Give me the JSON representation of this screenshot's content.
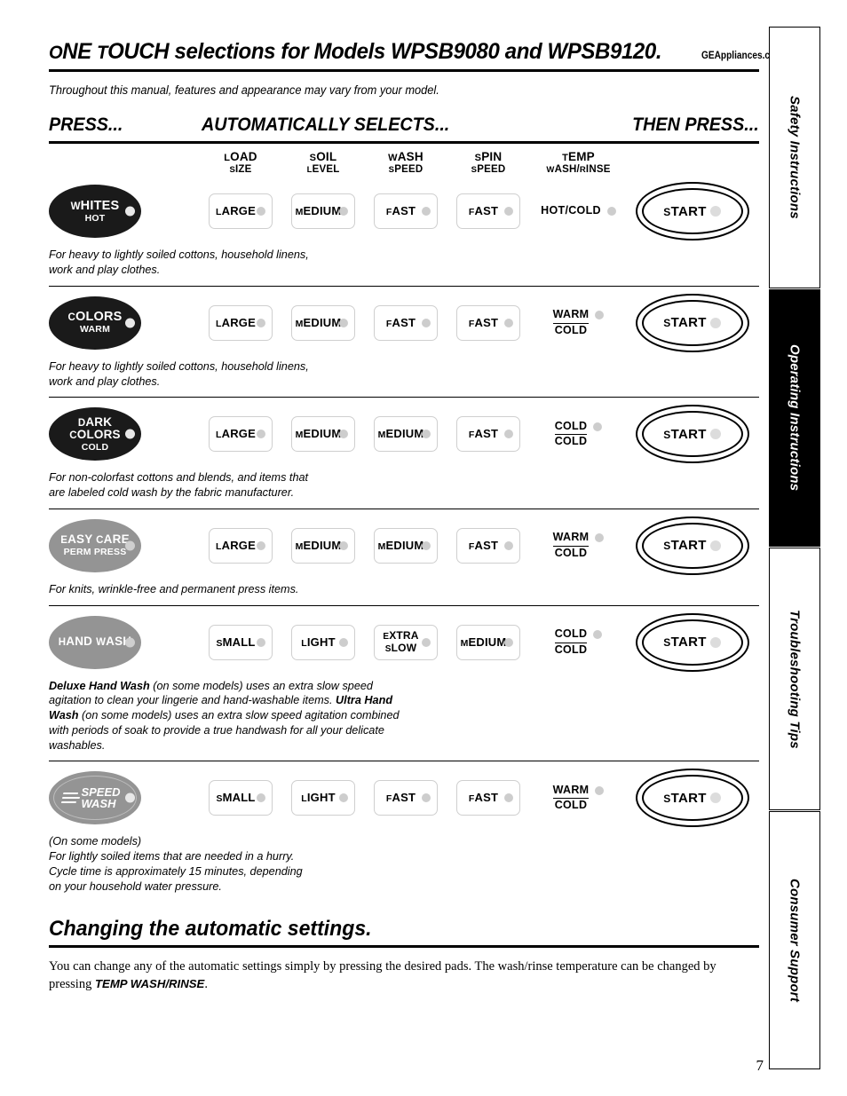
{
  "header": {
    "title_small_caps_1": "O",
    "title": "ONE TOUCH selections for Models WPSB9080 and WPSB9120.",
    "website": "GEAppliances.com",
    "intro": "Throughout this manual, features and appearance may vary from your model.",
    "col_press": "PRESS...",
    "col_auto": "AUTOMATICALLY SELECTS...",
    "col_then": "THEN PRESS..."
  },
  "subheaders": [
    {
      "line1": "LOAD",
      "line2": "SIZE"
    },
    {
      "line1": "SOIL",
      "line2": "LEVEL"
    },
    {
      "line1": "WASH",
      "line2": "SPEED"
    },
    {
      "line1": "SPIN",
      "line2": "SPEED"
    },
    {
      "line1": "TEMP",
      "line2": "WASH/RINSE"
    }
  ],
  "start_label": "START",
  "rows": [
    {
      "cycle": {
        "line1": "WHITES",
        "line2": "HOT",
        "style": "black",
        "two_line": false
      },
      "load": "LARGE",
      "soil": "MEDIUM",
      "wash": "FAST",
      "spin": "FAST",
      "temp": {
        "line1": "HOT/COLD",
        "line2": "",
        "two_line": false
      },
      "desc": "For heavy to lightly soiled cottons, household linens, work and play clothes."
    },
    {
      "cycle": {
        "line1": "COLORS",
        "line2": "WARM",
        "style": "black",
        "two_line": false
      },
      "load": "LARGE",
      "soil": "MEDIUM",
      "wash": "FAST",
      "spin": "FAST",
      "temp": {
        "line1": "WARM",
        "line2": "COLD",
        "two_line": true
      },
      "desc": "For heavy to lightly soiled cottons, household linens, work and play clothes."
    },
    {
      "cycle": {
        "line1": "DARK",
        "line1b": "COLORS",
        "line2": "COLD",
        "style": "black",
        "two_line": true
      },
      "load": "LARGE",
      "soil": "MEDIUM",
      "wash": "MEDIUM",
      "spin": "FAST",
      "temp": {
        "line1": "COLD",
        "line2": "COLD",
        "two_line": true
      },
      "desc": "For non-colorfast cottons and blends, and items that are labeled cold wash by the fabric manufacturer."
    },
    {
      "cycle": {
        "line1": "EASY CARE",
        "line2": "PERM PRESS",
        "style": "gray",
        "two_line": false
      },
      "load": "LARGE",
      "soil": "MEDIUM",
      "wash": "MEDIUM",
      "spin": "FAST",
      "temp": {
        "line1": "WARM",
        "line2": "COLD",
        "two_line": true
      },
      "desc": "For knits, wrinkle-free and permanent press items."
    },
    {
      "cycle": {
        "line1": "HAND WASH",
        "line2": "",
        "style": "gray",
        "two_line": false
      },
      "load": "SMALL",
      "soil": "LIGHT",
      "wash": "EXTRA SLOW",
      "wash_line1": "EXTRA",
      "wash_line2": "SLOW",
      "spin": "MEDIUM",
      "temp": {
        "line1": "COLD",
        "line2": "COLD",
        "two_line": true
      },
      "desc": "Deluxe Hand Wash (on some models) uses an extra slow speed agitation to clean your lingerie and hand-washable items. Ultra Hand Wash (on some models) uses an extra slow speed agitation combined with periods of soak to provide a true handwash for all your delicate washables.",
      "desc_bold_1": "Deluxe Hand Wash",
      "desc_part_1": " (on some models) uses an extra slow speed agitation to clean your lingerie and hand-washable items. ",
      "desc_bold_2": "Ultra Hand Wash",
      "desc_part_2": " (on some models) uses an extra slow speed agitation combined with periods of soak to provide a true handwash for all your delicate washables."
    },
    {
      "cycle": {
        "line1": "SPEED",
        "line2": "WASH",
        "style": "speed",
        "two_line": true
      },
      "load": "SMALL",
      "soil": "LIGHT",
      "wash": "FAST",
      "spin": "FAST",
      "temp": {
        "line1": "WARM",
        "line2": "COLD",
        "two_line": true
      },
      "desc": "(On some models) For lightly soiled items that are needed in a hurry. Cycle time is approximately 15 minutes, depending on your household water pressure.",
      "desc_line_1": "(On some models)",
      "desc_line_2": "For lightly soiled items that are needed in a hurry.",
      "desc_line_3": "Cycle time is approximately 15 minutes, depending",
      "desc_line_4": "on your household water pressure."
    }
  ],
  "footer": {
    "section_title": "Changing the automatic settings.",
    "body_part_1": "You can change any of the automatic settings simply by pressing the desired pads. The wash/rinse temperature can be changed by pressing ",
    "body_bold": "TEMP WASH/RINSE",
    "body_part_2": ".",
    "page_number": "7"
  },
  "sidebar": {
    "tabs": [
      {
        "label": "Safety Instructions",
        "active": false
      },
      {
        "label": "Operating Instructions",
        "active": true
      },
      {
        "label": "Troubleshooting Tips",
        "active": false
      },
      {
        "label": "Consumer Support",
        "active": false
      }
    ]
  }
}
